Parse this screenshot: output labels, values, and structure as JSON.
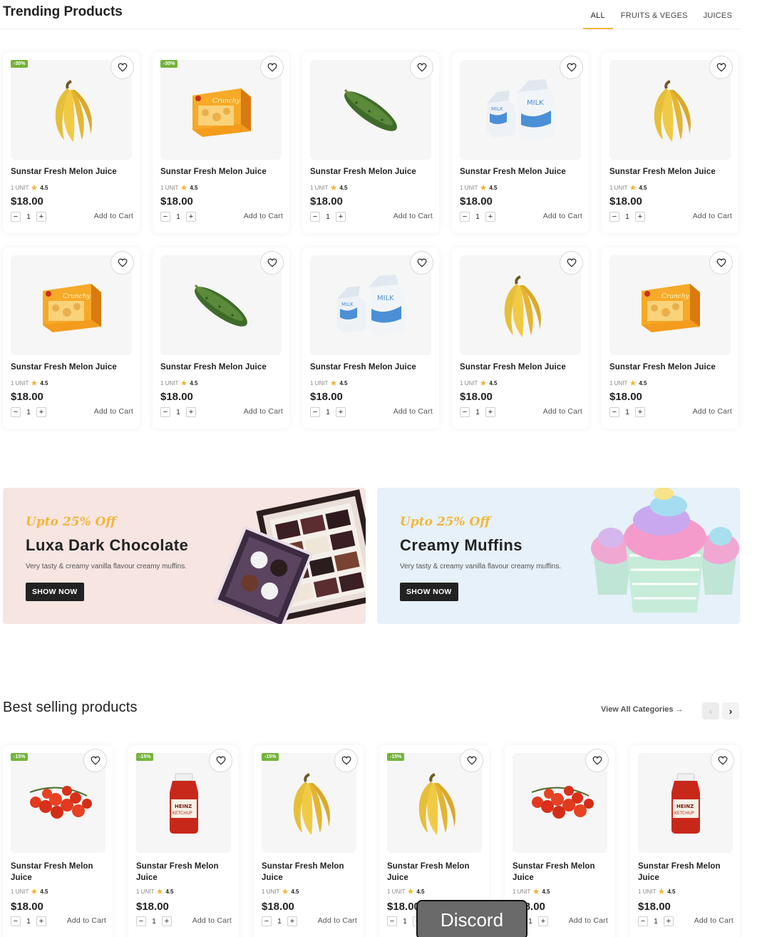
{
  "trending": {
    "title": "Trending Products",
    "tabs": [
      {
        "label": "ALL",
        "active": true
      },
      {
        "label": "FRUITS & VEGES",
        "active": false
      },
      {
        "label": "JUICES",
        "active": false
      }
    ],
    "products": [
      {
        "name": "Sunstar Fresh Melon Juice",
        "unit": "1 UNIT",
        "rating": "4.5",
        "price": "$18.00",
        "qty": "1",
        "cart": "Add to Cart",
        "badge": "-30%",
        "image": "banana"
      },
      {
        "name": "Sunstar Fresh Melon Juice",
        "unit": "1 UNIT",
        "rating": "4.5",
        "price": "$18.00",
        "qty": "1",
        "cart": "Add to Cart",
        "badge": "-30%",
        "image": "cookies-box"
      },
      {
        "name": "Sunstar Fresh Melon Juice",
        "unit": "1 UNIT",
        "rating": "4.5",
        "price": "$18.00",
        "qty": "1",
        "cart": "Add to Cart",
        "badge": "",
        "image": "cucumber"
      },
      {
        "name": "Sunstar Fresh Melon Juice",
        "unit": "1 UNIT",
        "rating": "4.5",
        "price": "$18.00",
        "qty": "1",
        "cart": "Add to Cart",
        "badge": "",
        "image": "milk"
      },
      {
        "name": "Sunstar Fresh Melon Juice",
        "unit": "1 UNIT",
        "rating": "4.5",
        "price": "$18.00",
        "qty": "1",
        "cart": "Add to Cart",
        "badge": "",
        "image": "banana"
      },
      {
        "name": "Sunstar Fresh Melon Juice",
        "unit": "1 UNIT",
        "rating": "4.5",
        "price": "$18.00",
        "qty": "1",
        "cart": "Add to Cart",
        "badge": "",
        "image": "cookies-box"
      },
      {
        "name": "Sunstar Fresh Melon Juice",
        "unit": "1 UNIT",
        "rating": "4.5",
        "price": "$18.00",
        "qty": "1",
        "cart": "Add to Cart",
        "badge": "",
        "image": "cucumber"
      },
      {
        "name": "Sunstar Fresh Melon Juice",
        "unit": "1 UNIT",
        "rating": "4.5",
        "price": "$18.00",
        "qty": "1",
        "cart": "Add to Cart",
        "badge": "",
        "image": "milk"
      },
      {
        "name": "Sunstar Fresh Melon Juice",
        "unit": "1 UNIT",
        "rating": "4.5",
        "price": "$18.00",
        "qty": "1",
        "cart": "Add to Cart",
        "badge": "",
        "image": "banana"
      },
      {
        "name": "Sunstar Fresh Melon Juice",
        "unit": "1 UNIT",
        "rating": "4.5",
        "price": "$18.00",
        "qty": "1",
        "cart": "Add to Cart",
        "badge": "",
        "image": "cookies-box"
      }
    ]
  },
  "banners": [
    {
      "offer": "Upto 25% Off",
      "title": "Luxa Dark Chocolate",
      "subtitle": "Very tasty & creamy vanilla flavour creamy muffins.",
      "button": "SHOW NOW",
      "bg": "#f6e5e1",
      "image": "chocolate-box"
    },
    {
      "offer": "Upto 25% Off",
      "title": "Creamy Muffins",
      "subtitle": "Very tasty & creamy vanilla flavour creamy muffins.",
      "button": "SHOW NOW",
      "bg": "#e6f1f9",
      "image": "cupcakes"
    }
  ],
  "best_selling": {
    "title": "Best selling products",
    "view_all": "View All Categories →",
    "prev_icon": "chevron-left-icon",
    "next_icon": "chevron-right-icon",
    "products": [
      {
        "name": "Sunstar Fresh Melon Juice",
        "unit": "1 UNIT",
        "rating": "4.5",
        "price": "$18.00",
        "qty": "1",
        "cart": "Add to Cart",
        "badge": "-15%",
        "image": "tomatoes"
      },
      {
        "name": "Sunstar Fresh Melon Juice",
        "unit": "1 UNIT",
        "rating": "4.5",
        "price": "$18.00",
        "qty": "1",
        "cart": "Add to Cart",
        "badge": "-15%",
        "image": "ketchup"
      },
      {
        "name": "Sunstar Fresh Melon Juice",
        "unit": "1 UNIT",
        "rating": "4.5",
        "price": "$18.00",
        "qty": "1",
        "cart": "Add to Cart",
        "badge": "-15%",
        "image": "banana"
      },
      {
        "name": "Sunstar Fresh Melon Juice",
        "unit": "1 UNIT",
        "rating": "4.5",
        "price": "$18.00",
        "qty": "1",
        "cart": "Add to Cart",
        "badge": "-15%",
        "image": "banana"
      },
      {
        "name": "Sunstar Fresh Melon Juice",
        "unit": "1 UNIT",
        "rating": "4.5",
        "price": "$18.00",
        "qty": "1",
        "cart": "Add to Cart",
        "badge": "",
        "image": "tomatoes"
      },
      {
        "name": "Sunstar Fresh Melon Juice",
        "unit": "1 UNIT",
        "rating": "4.5",
        "price": "$18.00",
        "qty": "1",
        "cart": "Add to Cart",
        "badge": "",
        "image": "ketchup"
      }
    ]
  },
  "overlay": {
    "discord": "Discord"
  },
  "colors": {
    "accent": "#f2b63c",
    "badge": "#74b33b",
    "dark": "#222222",
    "star": "#f2b63c"
  }
}
